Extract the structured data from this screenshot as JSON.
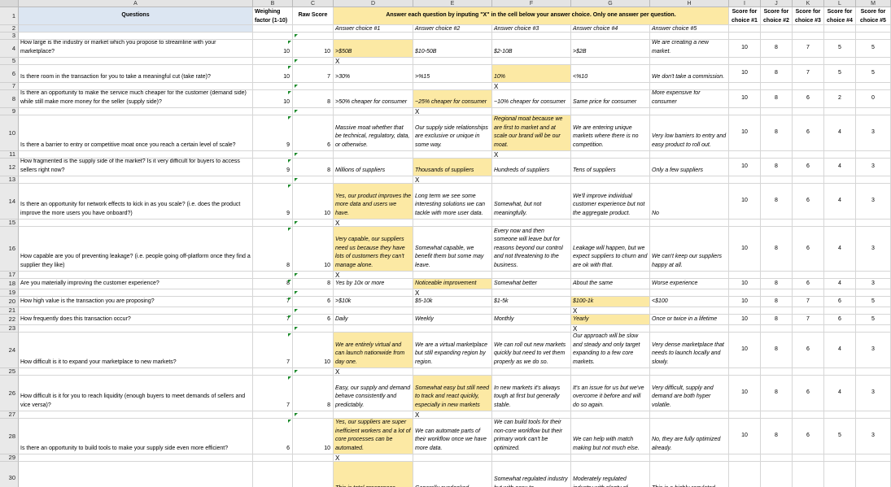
{
  "columns": [
    "A",
    "B",
    "C",
    "D",
    "E",
    "F",
    "G",
    "H",
    "I",
    "J",
    "K",
    "L",
    "M"
  ],
  "header": {
    "questions": "Questions",
    "weight": "Weighing factor (1-10)",
    "raw": "Raw Score",
    "instruction": "Answer each question by inputing \"X\" in the cell below your answer choice. Only one answer per question.",
    "choices": [
      "Answer choice #1",
      "Answer choice #2",
      "Answer choice #3",
      "Answer choice #4",
      "Answer choice #5"
    ],
    "scores": [
      "Score for choice #1",
      "Score for choice #2",
      "Score for choice #3",
      "Score for choice #4",
      "Score for choice #5"
    ]
  },
  "rows": [
    {
      "num": "4",
      "q": "How large is the industry or market which you propose to streamline with your marketplace?",
      "w": "10",
      "r": "10",
      "a": [
        ">$50B",
        "$10-50B",
        "$2-10B",
        ">$2B",
        "We are creating a new market."
      ],
      "sel": 0,
      "s": [
        "10",
        "8",
        "7",
        "5",
        "5"
      ]
    },
    {
      "num": "6",
      "q": "Is there room in the transaction for you to take a meaningful cut (take rate)?",
      "w": "10",
      "r": "7",
      "a": [
        ">30%",
        ">%15",
        "10%",
        "<%10",
        "We don't take a commission."
      ],
      "sel": 2,
      "s": [
        "10",
        "8",
        "7",
        "5",
        "5"
      ]
    },
    {
      "num": "8",
      "q": "Is there an opportunity to make the service much cheaper for the customer (demand side) while still make more money for the seller (supply side)?",
      "w": "10",
      "r": "8",
      "a": [
        ">50% cheaper for consumer",
        "~25% cheaper for consumer",
        "~10% cheaper for consumer",
        "Same price for consumer",
        "More expensive for consumer"
      ],
      "sel": 1,
      "s": [
        "10",
        "8",
        "6",
        "2",
        "0"
      ]
    },
    {
      "num": "10",
      "q": "Is there a barrier to entry or competitive moat once you reach a certain level of scale?",
      "w": "9",
      "r": "6",
      "a": [
        "Massive moat whether that be technical, regulatory, data, or otherwise.",
        "Our supply side relationships are exclusive or unique in some way.",
        "Regional moat because we are first to market and at scale our brand will be our moat.",
        "We are entering unique markets where there is no competition.",
        "Very low barriers to entry and easy product to roll out."
      ],
      "sel": 2,
      "s": [
        "10",
        "8",
        "6",
        "4",
        "3"
      ]
    },
    {
      "num": "12",
      "q": "How fragmented is the supply side of the market? Is it very difficult for buyers to access sellers right now?",
      "w": "9",
      "r": "8",
      "a": [
        "Millions of suppliers",
        "Thousands of suppliers",
        "Hundreds of suppliers",
        "Tens of suppliers",
        "Only a few suppliers"
      ],
      "sel": 1,
      "s": [
        "10",
        "8",
        "6",
        "4",
        "3"
      ]
    },
    {
      "num": "14",
      "q": "Is there an opportunity for network effects to kick in as you scale? (i.e. does the product improve the more users you have onboard?)",
      "w": "9",
      "r": "10",
      "a": [
        "Yes, our product improves the more data and users we have.",
        "Long term we see some interesting solutions we can tackle with more user data.",
        "Somewhat, but not meaningfully.",
        "We'll improve individual customer experience but not the aggregate product.",
        "No"
      ],
      "sel": 0,
      "s": [
        "10",
        "8",
        "6",
        "4",
        "3"
      ]
    },
    {
      "num": "16",
      "q": "How capable are you of preventing leakage? (i.e. people going off-platform once they find a supplier they like)",
      "w": "8",
      "r": "10",
      "a": [
        "Very capable, our suppliers need us because they have lots of customers they can't manage alone.",
        "Somewhat capable, we benefit them but some may leave.",
        "Every now and then someone will leave but for reasons beyond our control and not threatening to the business.",
        "Leakage will happen, but we expect suppliers to churn and are ok with that.",
        "We can't keep our suppliers happy at all."
      ],
      "sel": 0,
      "s": [
        "10",
        "8",
        "6",
        "4",
        "3"
      ]
    },
    {
      "num": "18",
      "q": "Are you materially improving the customer experience?",
      "w": "8",
      "r": "8",
      "a": [
        "Yes by 10x or more",
        "Noticeable improvement",
        "Somewhat better",
        "About the same",
        "Worse experience"
      ],
      "sel": 1,
      "s": [
        "10",
        "8",
        "6",
        "4",
        "3"
      ]
    },
    {
      "num": "20",
      "q": "How high value is the transaction you are proposing?",
      "w": "7",
      "r": "6",
      "a": [
        ">$10k",
        "$5-10k",
        "$1-5k",
        "$100-1k",
        "<$100"
      ],
      "sel": 3,
      "s": [
        "10",
        "8",
        "7",
        "6",
        "5"
      ]
    },
    {
      "num": "22",
      "q": "How frequently does this transaction occur?",
      "w": "7",
      "r": "6",
      "a": [
        "Daily",
        "Weekly",
        "Monthly",
        "Yearly",
        "Once or twice in a lifetime"
      ],
      "sel": 3,
      "s": [
        "10",
        "8",
        "7",
        "6",
        "5"
      ]
    },
    {
      "num": "24",
      "q": "How difficult is it to expand your marketplace to new markets?",
      "w": "7",
      "r": "10",
      "a": [
        "We are entirely virtual and can launch nationwide from day one.",
        "We are a virtual marketplace but still expanding region by region.",
        "We can roll out new markets quickly but need to vet them properly as we do so.",
        "Our approach will be slow and steady and only target expanding to a few core markets.",
        "Very dense marketplace that needs to launch locally and slowly."
      ],
      "sel": 0,
      "s": [
        "10",
        "8",
        "6",
        "4",
        "3"
      ]
    },
    {
      "num": "26",
      "q": "How difficult is it for you to reach liquidity (enough buyers to meet demands of sellers and vice versa)?",
      "w": "7",
      "r": "8",
      "a": [
        "Easy, our supply and demand behave consistently and predictably.",
        "Somewhat easy but still need to track and react quickly, especially in new markets",
        "In new markets it's always tough at first but generally stable.",
        "It's an issue for us but we've overcome it before and will do so again.",
        "Very difficult, supply and demand are both hyper volatile."
      ],
      "sel": 1,
      "s": [
        "10",
        "8",
        "6",
        "4",
        "3"
      ]
    },
    {
      "num": "28",
      "q": "Is there an opportunity to build tools to make your supply side even more efficient?",
      "w": "6",
      "r": "10",
      "a": [
        "Yes, our suppliers are super inefficient workers and a lot of core processes can be automated.",
        "We can automate parts of their workflow once we have more data.",
        "We can build tools for their non-core workflow but their primary work can't be optimized.",
        "We can help with match making but not much else.",
        "No, they are fully optimized already."
      ],
      "sel": 0,
      "s": [
        "10",
        "8",
        "6",
        "5",
        "3"
      ]
    },
    {
      "num": "30",
      "q": "",
      "w": "",
      "r": "",
      "a": [
        "This is total greenspace",
        "Generally overlooked",
        "Somewhat regulated industry but with easy-to-",
        "Moderately regulated industry with plenty of",
        "This is a highly-regulated"
      ],
      "sel": 0,
      "s": [
        "",
        "",
        "",
        "",
        ""
      ]
    }
  ],
  "x_mark": "X"
}
